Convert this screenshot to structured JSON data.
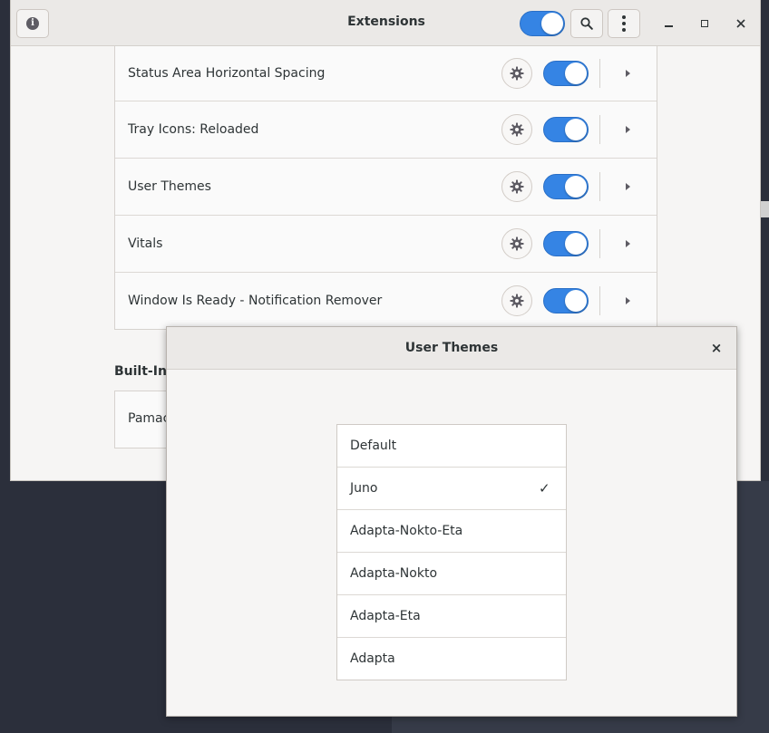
{
  "main_window": {
    "title": "Extensions",
    "extensions_enabled": true,
    "icons": {
      "about": "info-icon",
      "search": "search-icon",
      "menu": "kebab-menu-icon",
      "minimize": "minimize-icon",
      "maximize": "maximize-icon",
      "close": "close-icon"
    },
    "extensions": [
      {
        "name": "Status Area Horizontal Spacing",
        "enabled": true
      },
      {
        "name": "Tray Icons: Reloaded",
        "enabled": true
      },
      {
        "name": "User Themes",
        "enabled": true
      },
      {
        "name": "Vitals",
        "enabled": true
      },
      {
        "name": "Window Is Ready - Notification Remover",
        "enabled": true
      }
    ],
    "builtin_section_title": "Built-In",
    "builtin_first_item": "Pamac"
  },
  "dialog": {
    "title": "User Themes",
    "close_glyph": "×",
    "themes": [
      {
        "label": "Default",
        "selected": false
      },
      {
        "label": "Juno",
        "selected": true
      },
      {
        "label": "Adapta-Nokto-Eta",
        "selected": false
      },
      {
        "label": "Adapta-Nokto",
        "selected": false
      },
      {
        "label": "Adapta-Eta",
        "selected": false
      },
      {
        "label": "Adapta",
        "selected": false
      }
    ],
    "check_glyph": "✓"
  },
  "colors": {
    "accent": "#3584e4",
    "window_bg": "#f6f5f4",
    "desktop_bg": "#2b2f3b"
  }
}
